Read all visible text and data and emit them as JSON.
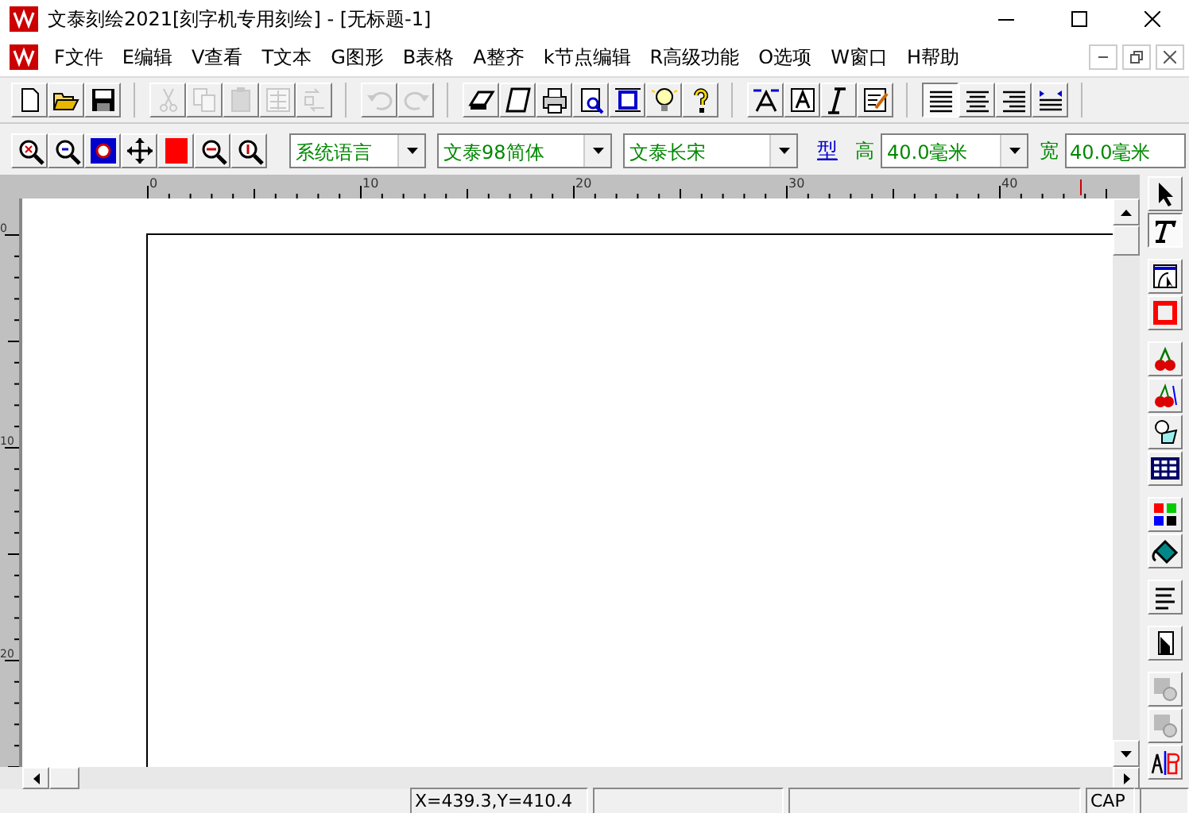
{
  "window": {
    "title": "文泰刻绘2021[刻字机专用刻绘] - [无标题-1]"
  },
  "menu": [
    "F文件",
    "E编辑",
    "V查看",
    "T文本",
    "G图形",
    "B表格",
    "A整齐",
    "k节点编辑",
    "R高级功能",
    "O选项",
    "W窗口",
    "H帮助"
  ],
  "toolbar": [
    [
      {
        "kind": "new",
        "disabled": false
      },
      {
        "kind": "open",
        "disabled": false
      },
      {
        "kind": "save",
        "disabled": false
      }
    ],
    [
      {
        "kind": "cut",
        "disabled": true
      },
      {
        "kind": "copy",
        "disabled": true
      },
      {
        "kind": "paste",
        "disabled": true
      },
      {
        "kind": "paste-special",
        "disabled": true
      },
      {
        "kind": "replace",
        "disabled": true
      }
    ],
    [
      {
        "kind": "undo",
        "disabled": true
      },
      {
        "kind": "redo",
        "disabled": true
      }
    ],
    [
      {
        "kind": "scan",
        "disabled": false
      },
      {
        "kind": "frame",
        "disabled": false
      },
      {
        "kind": "print",
        "disabled": false
      },
      {
        "kind": "preview",
        "disabled": false
      },
      {
        "kind": "fit",
        "disabled": false
      },
      {
        "kind": "bulb",
        "disabled": false
      },
      {
        "kind": "help",
        "disabled": false
      }
    ],
    [
      {
        "kind": "spread",
        "disabled": false
      },
      {
        "kind": "textbox",
        "disabled": false
      },
      {
        "kind": "italic",
        "disabled": false
      },
      {
        "kind": "edit",
        "disabled": false
      }
    ],
    [
      {
        "kind": "align-left",
        "selected": true
      },
      {
        "kind": "align-center",
        "selected": false
      },
      {
        "kind": "align-right",
        "selected": false
      },
      {
        "kind": "justify",
        "selected": false
      }
    ]
  ],
  "zoombar": [
    {
      "kind": "zoom-in"
    },
    {
      "kind": "zoom-out"
    },
    {
      "kind": "zoom-page"
    },
    {
      "kind": "pan"
    },
    {
      "kind": "color"
    },
    {
      "kind": "zoom-x"
    },
    {
      "kind": "zoom-y"
    }
  ],
  "fontbar": {
    "language": "系统语言",
    "font": "文泰98简体",
    "font_2": "文泰长宋",
    "style_button": "型",
    "height_label": "高",
    "height": "40.0毫米",
    "width_label": "宽",
    "width": "40.0毫米"
  },
  "ruler": {
    "horizontal": [
      "0",
      "10",
      "20",
      "30",
      "40"
    ],
    "vertical": [
      "0",
      "10",
      "20"
    ]
  },
  "palette": [
    {
      "kind": "pointer",
      "selected": false
    },
    {
      "kind": "text",
      "selected": true
    },
    {
      "kind": "node",
      "selected": false
    },
    {
      "kind": "rect",
      "selected": false
    },
    {
      "kind": "cherry",
      "selected": false
    },
    {
      "kind": "cherry-2",
      "selected": false
    },
    {
      "kind": "shape",
      "selected": false
    },
    {
      "kind": "table",
      "selected": false
    },
    {
      "kind": "colors",
      "selected": false
    },
    {
      "kind": "fill",
      "selected": false
    },
    {
      "kind": "lines",
      "selected": false
    },
    {
      "kind": "door",
      "selected": false
    },
    {
      "kind": "gray-1",
      "selected": false
    },
    {
      "kind": "gray-2",
      "selected": false
    },
    {
      "kind": "ab",
      "selected": false
    }
  ],
  "status_bar": {
    "coordinates": "X=439.3,Y=410.4",
    "caps": "CAP"
  }
}
